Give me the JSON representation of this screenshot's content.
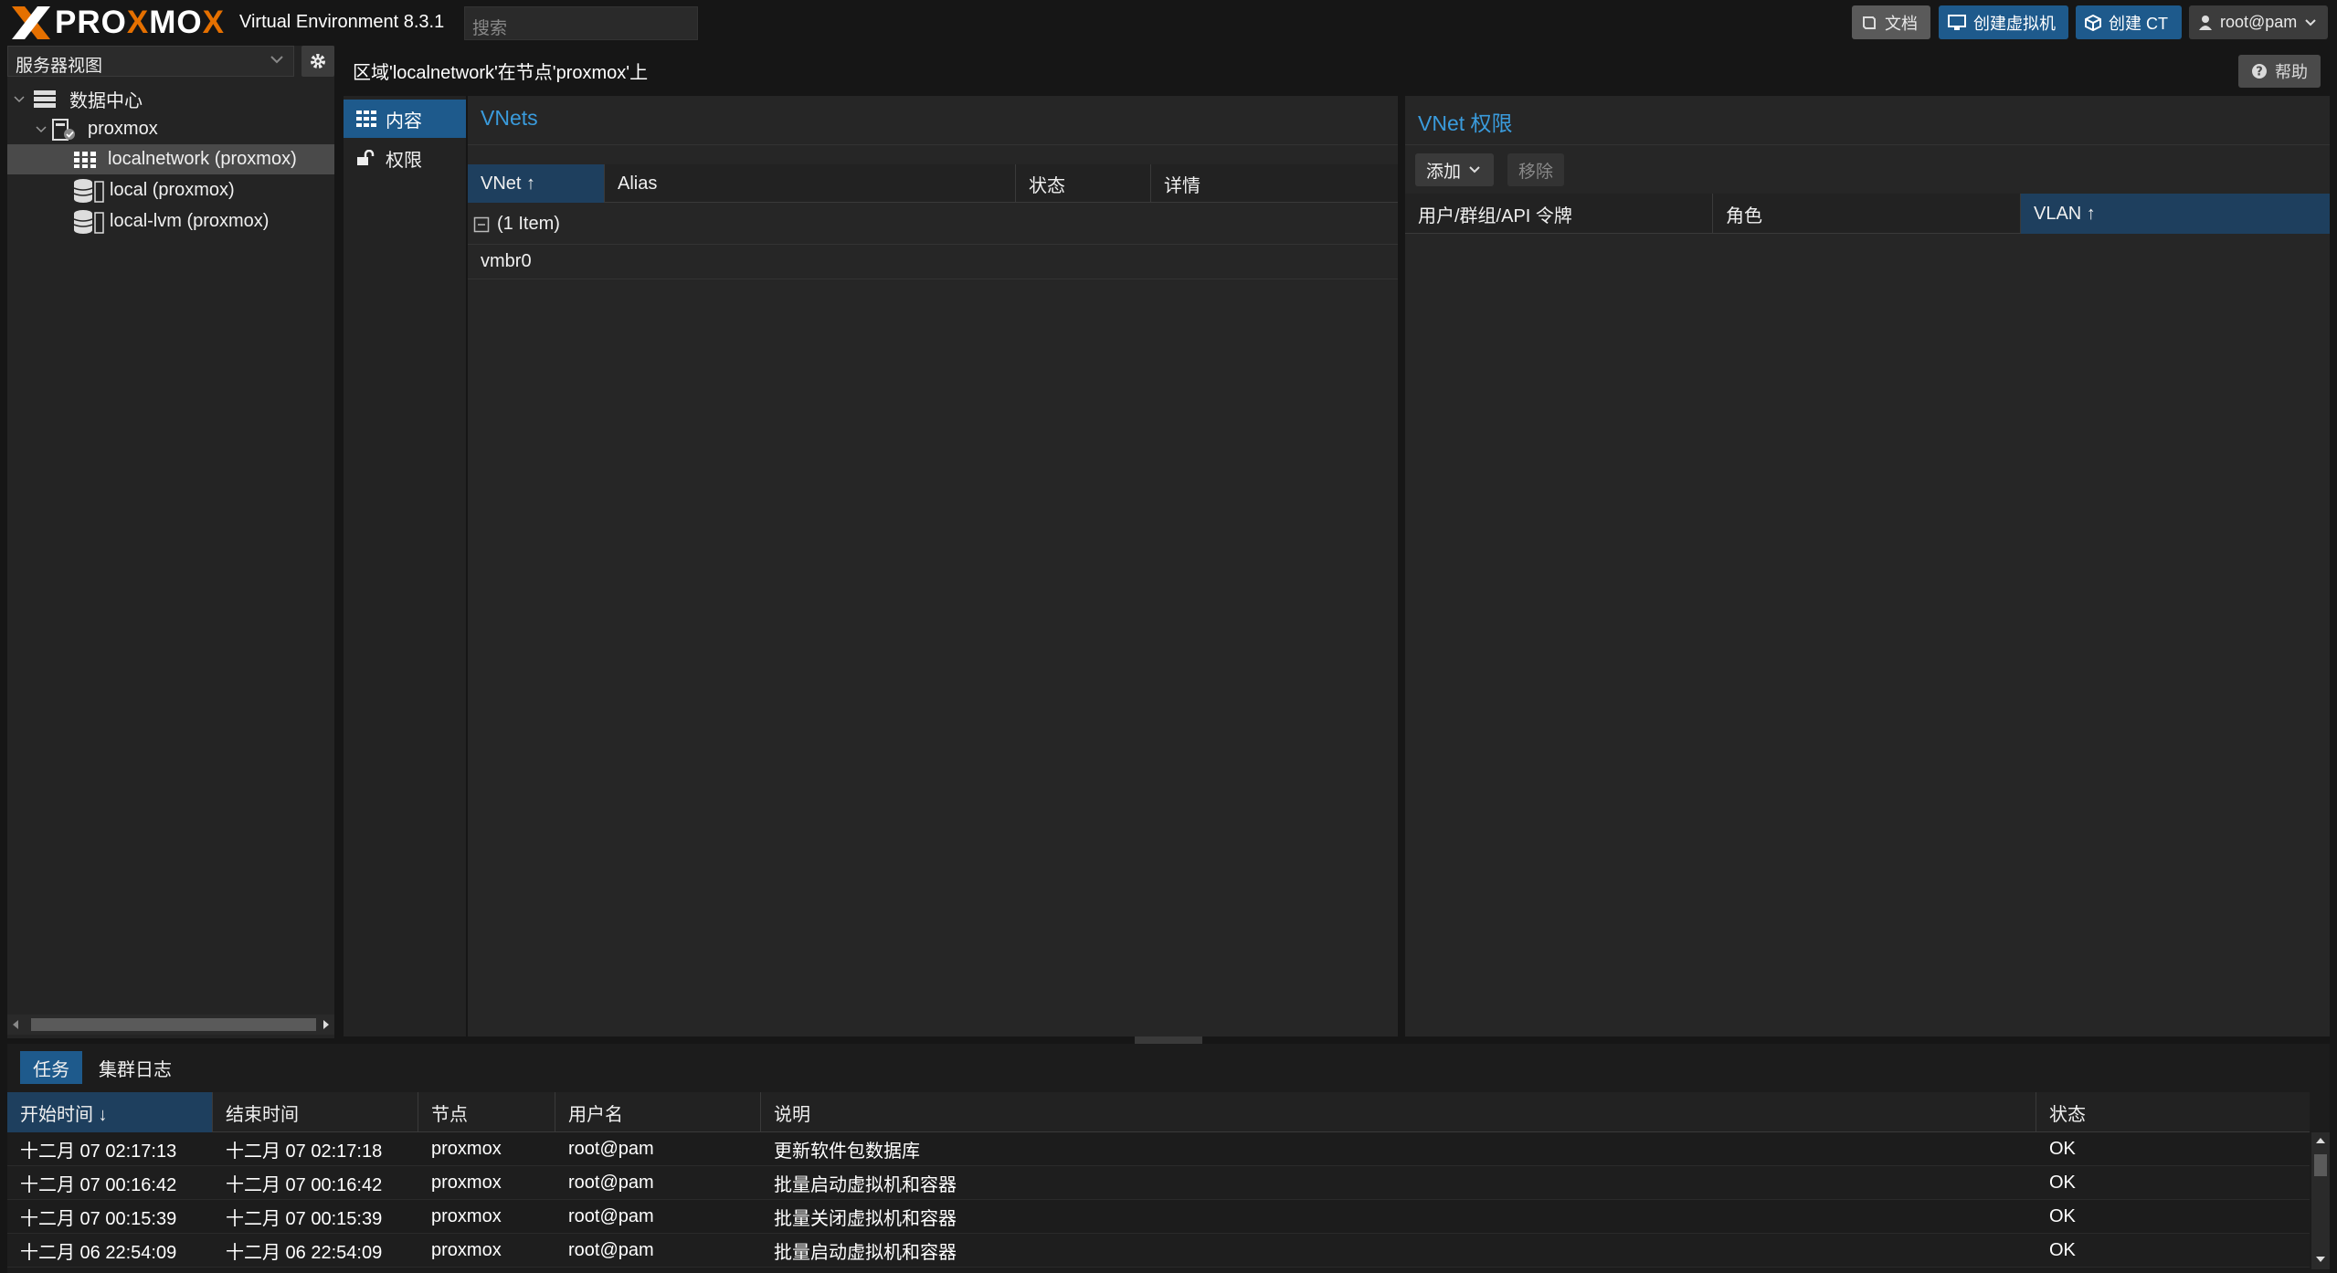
{
  "header": {
    "logo_text_1": "PRO",
    "logo_text_x": "X",
    "logo_text_2": "MO",
    "logo_text_x2": "X",
    "version": "Virtual Environment 8.3.1",
    "search_placeholder": "搜索",
    "buttons": {
      "docs": "文档",
      "create_vm": "创建虚拟机",
      "create_ct": "创建 CT",
      "user": "root@pam"
    }
  },
  "sidebar": {
    "view_selector": "服务器视图",
    "tree": [
      {
        "label": "数据中心"
      },
      {
        "label": "proxmox"
      },
      {
        "label": "localnetwork (proxmox)"
      },
      {
        "label": "local (proxmox)"
      },
      {
        "label": "local-lvm (proxmox)"
      }
    ]
  },
  "main": {
    "breadcrumb": "区域'localnetwork'在节点'proxmox'上",
    "help_label": "帮助",
    "nav": [
      {
        "label": "内容"
      },
      {
        "label": "权限"
      }
    ],
    "vnets": {
      "title": "VNets",
      "columns": [
        "VNet ↑",
        "Alias",
        "状态",
        "详情"
      ],
      "group_label": "(1 Item)",
      "rows": [
        {
          "vnet": "vmbr0"
        }
      ]
    },
    "permissions": {
      "title": "VNet 权限",
      "add_label": "添加",
      "remove_label": "移除",
      "columns": [
        "用户/群组/API 令牌",
        "角色",
        "VLAN ↑"
      ]
    }
  },
  "tasks": {
    "tabs": [
      "任务",
      "集群日志"
    ],
    "columns": [
      "开始时间 ↓",
      "结束时间",
      "节点",
      "用户名",
      "说明",
      "状态"
    ],
    "rows": [
      {
        "start": "十二月 07 02:17:13",
        "end": "十二月 07 02:17:18",
        "node": "proxmox",
        "user": "root@pam",
        "desc": "更新软件包数据库",
        "status": "OK"
      },
      {
        "start": "十二月 07 00:16:42",
        "end": "十二月 07 00:16:42",
        "node": "proxmox",
        "user": "root@pam",
        "desc": "批量启动虚拟机和容器",
        "status": "OK"
      },
      {
        "start": "十二月 07 00:15:39",
        "end": "十二月 07 00:15:39",
        "node": "proxmox",
        "user": "root@pam",
        "desc": "批量关闭虚拟机和容器",
        "status": "OK"
      },
      {
        "start": "十二月 06 22:54:09",
        "end": "十二月 06 22:54:09",
        "node": "proxmox",
        "user": "root@pam",
        "desc": "批量启动虚拟机和容器",
        "status": "OK"
      }
    ]
  }
}
